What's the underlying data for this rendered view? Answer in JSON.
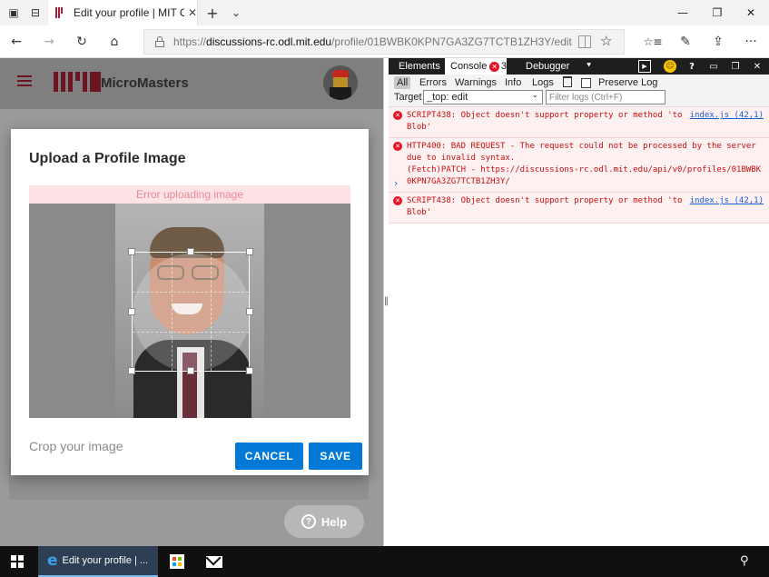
{
  "browser": {
    "tab_title": "Edit your profile | MIT C",
    "tab_close_icon": "✕",
    "new_tab_icon": "+",
    "tab_menu_icon": "⌄",
    "minimize_icon": "—",
    "restore_icon": "❐",
    "close_icon": "✕",
    "back_icon": "←",
    "forward_icon": "→",
    "refresh_icon": "↻",
    "home_icon": "⌂",
    "url_prefix": "https://",
    "url_host": "discussions-rc.odl.mit.edu",
    "url_path": "/profile/01BWBK0KPN7GA3ZG7TCTB1ZH3Y/edit",
    "favorite_icon": "☆",
    "hub_icon": "☆≡",
    "notes_icon": "✎",
    "share_icon": "⇪",
    "more_icon": "···"
  },
  "app": {
    "brand": "MicroMasters"
  },
  "dialog": {
    "title": "Upload a Profile Image",
    "error_text": "Error uploading image",
    "crop_hint": "Crop your image",
    "cancel_label": "CANCEL",
    "save_label": "SAVE"
  },
  "help": {
    "label": "Help",
    "icon": "?"
  },
  "devtools": {
    "tabs": {
      "elements": "Elements",
      "console": "Console",
      "console_error_count": "3",
      "debugger": "Debugger",
      "overflow_icon": "⯆"
    },
    "toolbar_icons": {
      "terminal": "▶",
      "feedback": "☺",
      "help": "?",
      "dock": "▭",
      "undock": "❐",
      "close": "✕"
    },
    "filters": [
      "All",
      "Errors",
      "Warnings",
      "Info",
      "Logs"
    ],
    "preserve_log_label": "Preserve Log",
    "target_label": "Target",
    "target_value": "_top: edit",
    "filter_placeholder": "Filter logs (Ctrl+F)",
    "messages": [
      {
        "lines": [
          "SCRIPT438: Object doesn't support property or method 'to",
          "Blob'"
        ],
        "source": "index.js (42,1)"
      },
      {
        "lines": [
          "HTTP400: BAD REQUEST - The request could not be processed by the server",
          "due to invalid syntax.",
          "(Fetch)PATCH - https://discussions-rc.odl.mit.edu/api/v0/profiles/01BWBK",
          "0KPN7GA3ZG7TCTB1ZH3Y/"
        ],
        "source": ""
      },
      {
        "lines": [
          "SCRIPT438: Object doesn't support property or method 'to",
          "Blob'"
        ],
        "source": "index.js (42,1)"
      }
    ],
    "prompt": "›"
  },
  "taskbar": {
    "edge_label": "Edit your profile | ...",
    "edge_icon": "e",
    "people_icon": "⚲"
  },
  "colors": {
    "mit_red": "#a31f34",
    "primary_button": "#0278d7",
    "error_text": "#c80f0f",
    "link": "#1a5fd6"
  }
}
